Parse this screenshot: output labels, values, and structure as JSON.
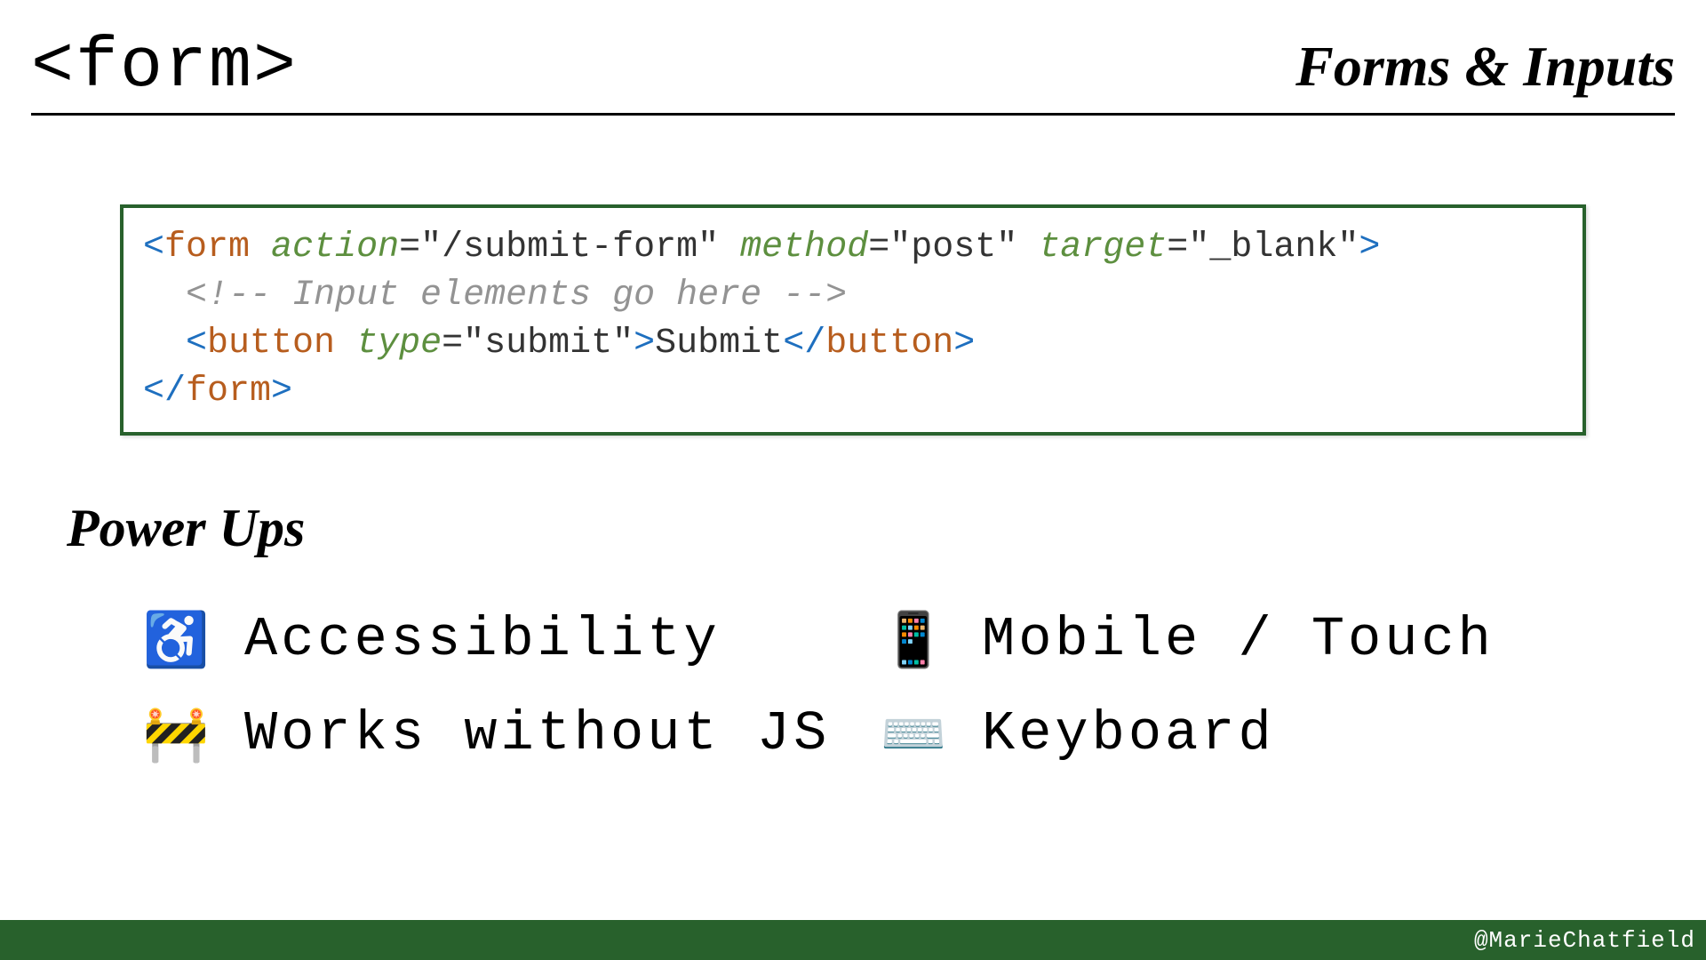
{
  "header": {
    "title": "<form>",
    "category": "Forms & Inputs"
  },
  "code": {
    "line1": {
      "lt1": "<",
      "tag1": "form",
      "sp1": " ",
      "attr1": "action",
      "eq1": "=",
      "val1": "\"/submit-form\"",
      "sp2": " ",
      "attr2": "method",
      "eq2": "=",
      "val2": "\"post\"",
      "sp3": " ",
      "attr3": "target",
      "eq3": "=",
      "val3": "\"_blank\"",
      "gt1": ">"
    },
    "line2": {
      "indent": "  ",
      "comment": "<!-- Input elements go here -->"
    },
    "line3": {
      "indent": "  ",
      "lt1": "<",
      "tag1": "button",
      "sp1": " ",
      "attr1": "type",
      "eq1": "=",
      "val1": "\"submit\"",
      "gt1": ">",
      "text": "Submit",
      "lt2": "</",
      "tag2": "button",
      "gt2": ">"
    },
    "line4": {
      "lt1": "</",
      "tag1": "form",
      "gt1": ">"
    }
  },
  "powerups": {
    "heading": "Power Ups",
    "items": [
      {
        "icon": "♿",
        "label": "Accessibility"
      },
      {
        "icon": "📱",
        "label": "Mobile / Touch"
      },
      {
        "icon": "🚧",
        "label": "Works without JS"
      },
      {
        "icon": "⌨️",
        "label": "Keyboard"
      }
    ]
  },
  "footer": {
    "handle": "@MarieChatfield"
  }
}
